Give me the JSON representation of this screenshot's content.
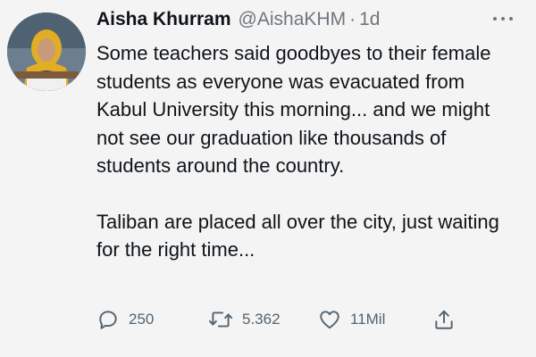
{
  "author": {
    "name": "Aisha Khurram",
    "handle": "@AishaKHM",
    "separator": "·",
    "time": "1d"
  },
  "tweet": {
    "paragraphs": [
      "Some teachers said goodbyes to their female students as everyone was evacuated from Kabul University this morning... and we might not see our graduation like thousands of students around the country.",
      "Taliban are placed all over the city, just waiting for the right time..."
    ]
  },
  "actions": {
    "reply": {
      "icon": "reply-icon",
      "count": "250"
    },
    "retweet": {
      "icon": "retweet-icon",
      "count": "5.362"
    },
    "like": {
      "icon": "heart-icon",
      "count": "11Mil"
    },
    "share": {
      "icon": "share-icon"
    }
  },
  "colors": {
    "text": "#0f1419",
    "secondary": "#6e767d",
    "icon": "#536471",
    "background": "#f4f4f4"
  }
}
